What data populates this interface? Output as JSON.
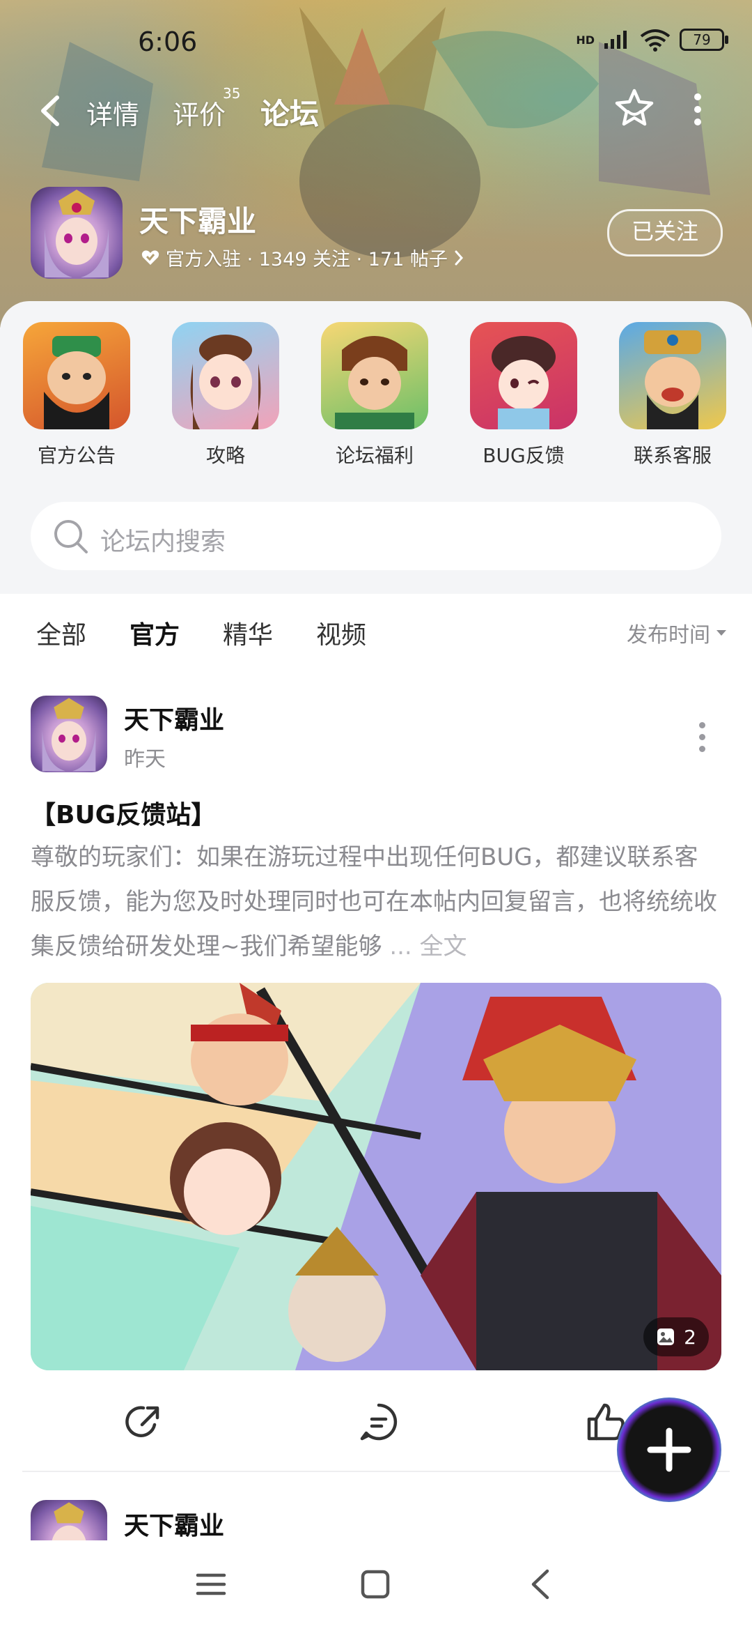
{
  "status_bar": {
    "time": "6:06",
    "network": "HD",
    "battery": "79"
  },
  "nav": {
    "tabs": [
      {
        "label": "详情"
      },
      {
        "label": "评价",
        "badge": "35"
      },
      {
        "label": "论坛"
      }
    ],
    "active_tab": "论坛"
  },
  "game": {
    "title": "天下霸业",
    "meta": "官方入驻 · 1349 关注 · 171 帖子",
    "follow_label": "已关注"
  },
  "shortcuts": [
    {
      "label": "官方公告"
    },
    {
      "label": "攻略"
    },
    {
      "label": "论坛福利"
    },
    {
      "label": "BUG反馈"
    },
    {
      "label": "联系客服"
    }
  ],
  "search": {
    "placeholder": "论坛内搜索"
  },
  "filters": {
    "tabs": [
      {
        "label": "全部"
      },
      {
        "label": "官方"
      },
      {
        "label": "精华"
      },
      {
        "label": "视频"
      }
    ],
    "active": "官方",
    "sort_label": "发布时间"
  },
  "post": {
    "author": "天下霸业",
    "time": "昨天",
    "title": "【BUG反馈站】",
    "body": "尊敬的玩家们：如果在游玩过程中出现任何BUG，都建议联系客服反馈，能为您及时处理同时也可在本帖内回复留言，也将统统收集反馈给研发处理~我们希望能够",
    "ellipsis": "...",
    "full_text_label": "全文",
    "image_count": "2"
  },
  "post2": {
    "author": "天下霸业"
  },
  "colors": {
    "accent": "#35d1b0",
    "panel_bg": "#f4f5f7",
    "fab": "#141414"
  }
}
